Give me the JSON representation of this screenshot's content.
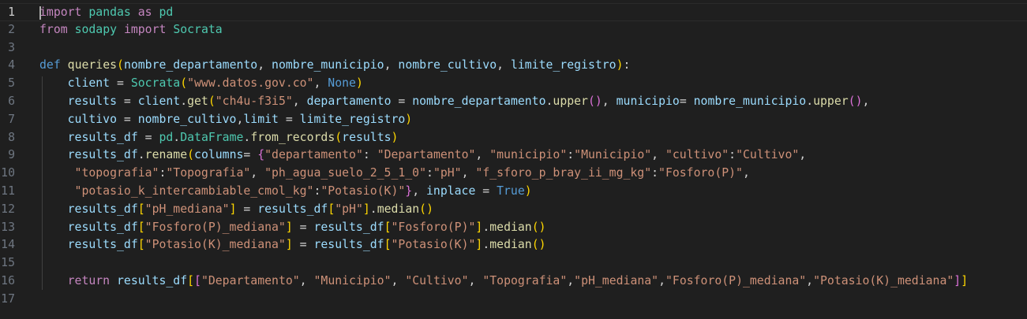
{
  "editor": {
    "language": "python",
    "colors": {
      "background": "#1f1f1f",
      "line_number": "#6e7681",
      "line_number_active": "#cccccc",
      "keyword": "#569cd6",
      "control_keyword": "#c586c0",
      "function": "#dcdcaa",
      "class": "#4ec9b0",
      "string": "#ce9178",
      "variable": "#9cdcfe",
      "bracket_level1": "#ffd700",
      "bracket_level2": "#da70d6",
      "bracket_level3": "#179fff"
    },
    "active_line": 1,
    "lines": [
      {
        "n": "1",
        "tokens": [
          [
            "k-ctrl",
            "import"
          ],
          [
            "op",
            " "
          ],
          [
            "cls",
            "pandas"
          ],
          [
            "op",
            " "
          ],
          [
            "k-ctrl",
            "as"
          ],
          [
            "op",
            " "
          ],
          [
            "cls",
            "pd"
          ]
        ]
      },
      {
        "n": "2",
        "tokens": [
          [
            "k-ctrl",
            "from"
          ],
          [
            "op",
            " "
          ],
          [
            "cls",
            "sodapy"
          ],
          [
            "op",
            " "
          ],
          [
            "k-ctrl",
            "import"
          ],
          [
            "op",
            " "
          ],
          [
            "cls",
            "Socrata"
          ]
        ]
      },
      {
        "n": "3",
        "tokens": []
      },
      {
        "n": "4",
        "tokens": [
          [
            "k-py",
            "def"
          ],
          [
            "op",
            " "
          ],
          [
            "fn",
            "queries"
          ],
          [
            "p1",
            "("
          ],
          [
            "var",
            "nombre_departamento"
          ],
          [
            "op",
            ", "
          ],
          [
            "var",
            "nombre_municipio"
          ],
          [
            "op",
            ", "
          ],
          [
            "var",
            "nombre_cultivo"
          ],
          [
            "op",
            ", "
          ],
          [
            "var",
            "limite_registro"
          ],
          [
            "p1",
            ")"
          ],
          [
            "op",
            ":"
          ]
        ]
      },
      {
        "n": "5",
        "tokens": [
          [
            "op",
            "    "
          ],
          [
            "var",
            "client"
          ],
          [
            "op",
            " = "
          ],
          [
            "cls",
            "Socrata"
          ],
          [
            "p1",
            "("
          ],
          [
            "str",
            "\"www.datos.gov.co\""
          ],
          [
            "op",
            ", "
          ],
          [
            "k-py",
            "None"
          ],
          [
            "p1",
            ")"
          ]
        ]
      },
      {
        "n": "6",
        "tokens": [
          [
            "op",
            "    "
          ],
          [
            "var",
            "results"
          ],
          [
            "op",
            " = "
          ],
          [
            "var",
            "client"
          ],
          [
            "op",
            "."
          ],
          [
            "fn",
            "get"
          ],
          [
            "p1",
            "("
          ],
          [
            "str",
            "\"ch4u-f3i5\""
          ],
          [
            "op",
            ", "
          ],
          [
            "var",
            "departamento"
          ],
          [
            "op",
            " = "
          ],
          [
            "var",
            "nombre_departamento"
          ],
          [
            "op",
            "."
          ],
          [
            "fn",
            "upper"
          ],
          [
            "p2",
            "()"
          ],
          [
            "op",
            ", "
          ],
          [
            "var",
            "municipio"
          ],
          [
            "op",
            "= "
          ],
          [
            "var",
            "nombre_municipio"
          ],
          [
            "op",
            "."
          ],
          [
            "fn",
            "upper"
          ],
          [
            "p2",
            "()"
          ],
          [
            "op",
            ","
          ]
        ]
      },
      {
        "n": "7",
        "tokens": [
          [
            "op",
            "    "
          ],
          [
            "var",
            "cultivo"
          ],
          [
            "op",
            " = "
          ],
          [
            "var",
            "nombre_cultivo"
          ],
          [
            "op",
            ","
          ],
          [
            "var",
            "limit"
          ],
          [
            "op",
            " = "
          ],
          [
            "var",
            "limite_registro"
          ],
          [
            "p1",
            ")"
          ]
        ]
      },
      {
        "n": "8",
        "tokens": [
          [
            "op",
            "    "
          ],
          [
            "var",
            "results_df"
          ],
          [
            "op",
            " = "
          ],
          [
            "cls",
            "pd"
          ],
          [
            "op",
            "."
          ],
          [
            "cls",
            "DataFrame"
          ],
          [
            "op",
            "."
          ],
          [
            "fn",
            "from_records"
          ],
          [
            "p1",
            "("
          ],
          [
            "var",
            "results"
          ],
          [
            "p1",
            ")"
          ]
        ]
      },
      {
        "n": "9",
        "tokens": [
          [
            "op",
            "    "
          ],
          [
            "var",
            "results_df"
          ],
          [
            "op",
            "."
          ],
          [
            "fn",
            "rename"
          ],
          [
            "p1",
            "("
          ],
          [
            "var",
            "columns"
          ],
          [
            "op",
            "= "
          ],
          [
            "p2",
            "{"
          ],
          [
            "str",
            "\"departamento\""
          ],
          [
            "op",
            ": "
          ],
          [
            "str",
            "\"Departamento\""
          ],
          [
            "op",
            ", "
          ],
          [
            "str",
            "\"municipio\""
          ],
          [
            "op",
            ":"
          ],
          [
            "str",
            "\"Municipio\""
          ],
          [
            "op",
            ", "
          ],
          [
            "str",
            "\"cultivo\""
          ],
          [
            "op",
            ":"
          ],
          [
            "str",
            "\"Cultivo\""
          ],
          [
            "op",
            ","
          ]
        ]
      },
      {
        "n": "10",
        "tokens": [
          [
            "op",
            "     "
          ],
          [
            "str",
            "\"topografia\""
          ],
          [
            "op",
            ":"
          ],
          [
            "str",
            "\"Topografia\""
          ],
          [
            "op",
            ", "
          ],
          [
            "str",
            "\"ph_agua_suelo_2_5_1_0\""
          ],
          [
            "op",
            ":"
          ],
          [
            "str",
            "\"pH\""
          ],
          [
            "op",
            ", "
          ],
          [
            "str",
            "\"f_sforo_p_bray_ii_mg_kg\""
          ],
          [
            "op",
            ":"
          ],
          [
            "str",
            "\"Fosforo(P)\""
          ],
          [
            "op",
            ","
          ]
        ]
      },
      {
        "n": "11",
        "tokens": [
          [
            "op",
            "     "
          ],
          [
            "str",
            "\"potasio_k_intercambiable_cmol_kg\""
          ],
          [
            "op",
            ":"
          ],
          [
            "str",
            "\"Potasio(K)\""
          ],
          [
            "p2",
            "}"
          ],
          [
            "op",
            ", "
          ],
          [
            "var",
            "inplace"
          ],
          [
            "op",
            " = "
          ],
          [
            "k-py",
            "True"
          ],
          [
            "p1",
            ")"
          ]
        ]
      },
      {
        "n": "12",
        "tokens": [
          [
            "op",
            "    "
          ],
          [
            "var",
            "results_df"
          ],
          [
            "p1",
            "["
          ],
          [
            "str",
            "\"pH_mediana\""
          ],
          [
            "p1",
            "]"
          ],
          [
            "op",
            " = "
          ],
          [
            "var",
            "results_df"
          ],
          [
            "p1",
            "["
          ],
          [
            "str",
            "\"pH\""
          ],
          [
            "p1",
            "]"
          ],
          [
            "op",
            "."
          ],
          [
            "fn",
            "median"
          ],
          [
            "p1",
            "()"
          ]
        ]
      },
      {
        "n": "13",
        "tokens": [
          [
            "op",
            "    "
          ],
          [
            "var",
            "results_df"
          ],
          [
            "p1",
            "["
          ],
          [
            "str",
            "\"Fosforo(P)_mediana\""
          ],
          [
            "p1",
            "]"
          ],
          [
            "op",
            " = "
          ],
          [
            "var",
            "results_df"
          ],
          [
            "p1",
            "["
          ],
          [
            "str",
            "\"Fosforo(P)\""
          ],
          [
            "p1",
            "]"
          ],
          [
            "op",
            "."
          ],
          [
            "fn",
            "median"
          ],
          [
            "p1",
            "()"
          ]
        ]
      },
      {
        "n": "14",
        "tokens": [
          [
            "op",
            "    "
          ],
          [
            "var",
            "results_df"
          ],
          [
            "p1",
            "["
          ],
          [
            "str",
            "\"Potasio(K)_mediana\""
          ],
          [
            "p1",
            "]"
          ],
          [
            "op",
            " = "
          ],
          [
            "var",
            "results_df"
          ],
          [
            "p1",
            "["
          ],
          [
            "str",
            "\"Potasio(K)\""
          ],
          [
            "p1",
            "]"
          ],
          [
            "op",
            "."
          ],
          [
            "fn",
            "median"
          ],
          [
            "p1",
            "()"
          ]
        ]
      },
      {
        "n": "15",
        "tokens": []
      },
      {
        "n": "16",
        "tokens": [
          [
            "op",
            "    "
          ],
          [
            "k-ctrl",
            "return"
          ],
          [
            "op",
            " "
          ],
          [
            "var",
            "results_df"
          ],
          [
            "p1",
            "["
          ],
          [
            "p2",
            "["
          ],
          [
            "str",
            "\"Departamento\""
          ],
          [
            "op",
            ", "
          ],
          [
            "str",
            "\"Municipio\""
          ],
          [
            "op",
            ", "
          ],
          [
            "str",
            "\"Cultivo\""
          ],
          [
            "op",
            ", "
          ],
          [
            "str",
            "\"Topografia\""
          ],
          [
            "op",
            ","
          ],
          [
            "str",
            "\"pH_mediana\""
          ],
          [
            "op",
            ","
          ],
          [
            "str",
            "\"Fosforo(P)_mediana\""
          ],
          [
            "op",
            ","
          ],
          [
            "str",
            "\"Potasio(K)_mediana\""
          ],
          [
            "p2",
            "]"
          ],
          [
            "p1",
            "]"
          ]
        ]
      },
      {
        "n": "17",
        "tokens": []
      }
    ]
  }
}
